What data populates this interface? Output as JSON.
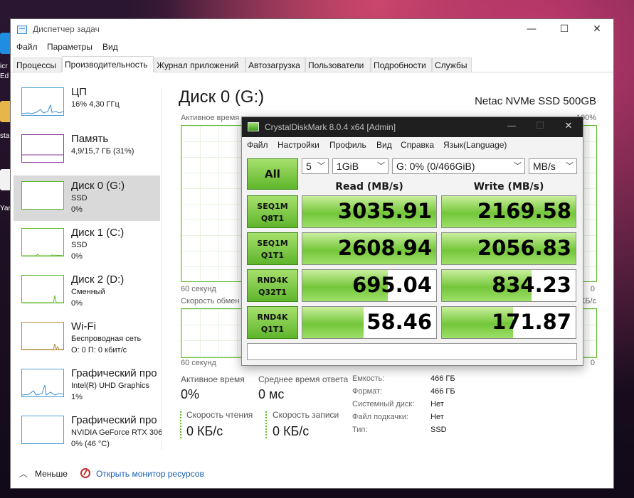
{
  "desktop": {
    "labels": [
      "icr",
      "Ed",
      "sta",
      "Yar"
    ]
  },
  "taskmanager": {
    "title": "Диспетчер задач",
    "menu": [
      "Файл",
      "Параметры",
      "Вид"
    ],
    "tabs": [
      "Процессы",
      "Производительность",
      "Журнал приложений",
      "Автозагрузка",
      "Пользователи",
      "Подробности",
      "Службы"
    ],
    "sidebar": [
      {
        "name": "ЦП",
        "sub1": "16% 4,30 ГГц",
        "sub2": ""
      },
      {
        "name": "Память",
        "sub1": "4,9/15,7 ГБ (31%)",
        "sub2": ""
      },
      {
        "name": "Диск 0 (G:)",
        "sub1": "SSD",
        "sub2": "0%"
      },
      {
        "name": "Диск 1 (C:)",
        "sub1": "SSD",
        "sub2": "0%"
      },
      {
        "name": "Диск 2 (D:)",
        "sub1": "Сменный",
        "sub2": "0%"
      },
      {
        "name": "Wi-Fi",
        "sub1": "Беспроводная сеть",
        "sub2": "О: 0 П: 0 кбит/с"
      },
      {
        "name": "Графический про",
        "sub1": "Intel(R) UHD Graphics",
        "sub2": "1%"
      },
      {
        "name": "Графический про",
        "sub1": "NVIDIA GeForce RTX 306",
        "sub2": "0% (46 °C)"
      }
    ],
    "main": {
      "title": "Диск 0 (G:)",
      "model": "Netac NVMe SSD 500GB",
      "graph1_label": "Активное время",
      "graph1_max": "100%",
      "graph_time": "60 секунд",
      "graph2_label": "Скорость обмен",
      "graph2_max": "КБ/с",
      "graph_zero": "0",
      "stats": {
        "active_label": "Активное время",
        "active_value": "0%",
        "resp_label": "Среднее время ответа",
        "resp_value": "0 мс",
        "read_label": "Скорость чтения",
        "read_value": "0 КБ/с",
        "write_label": "Скорость записи",
        "write_value": "0 КБ/с"
      },
      "props": [
        {
          "label": "Емкость:",
          "value": "466 ГБ"
        },
        {
          "label": "Формат:",
          "value": "466 ГБ"
        },
        {
          "label": "Системный диск:",
          "value": "Нет"
        },
        {
          "label": "Файл подкачки:",
          "value": "Нет"
        },
        {
          "label": "Тип:",
          "value": "SSD"
        }
      ]
    },
    "footer": {
      "less": "Меньше",
      "resource_monitor": "Открыть монитор ресурсов"
    }
  },
  "cdm": {
    "title": "CrystalDiskMark 8.0.4 x64 [Admin]",
    "menu": [
      "Файл",
      "Настройки",
      "Профиль",
      "Вид",
      "Справка",
      "Язык(Language)"
    ],
    "all_label": "All",
    "count": "5",
    "size": "1GiB",
    "drive": "G: 0% (0/466GiB)",
    "unit": "MB/s",
    "read_header": "Read (MB/s)",
    "write_header": "Write (MB/s)",
    "tests": [
      {
        "l1": "SEQ1M",
        "l2": "Q8T1",
        "read": "3035.91",
        "write": "2169.58",
        "read_level": 1.0,
        "write_level": 1.0
      },
      {
        "l1": "SEQ1M",
        "l2": "Q1T1",
        "read": "2608.94",
        "write": "2056.83",
        "read_level": 1.0,
        "write_level": 1.0
      },
      {
        "l1": "RND4K",
        "l2": "Q32T1",
        "read": "695.04",
        "write": "834.23",
        "read_level": 0.64,
        "write_level": 0.67
      },
      {
        "l1": "RND4K",
        "l2": "Q1T1",
        "read": "58.46",
        "write": "171.87",
        "read_level": 0.46,
        "write_level": 0.53
      }
    ],
    "comment": ""
  }
}
